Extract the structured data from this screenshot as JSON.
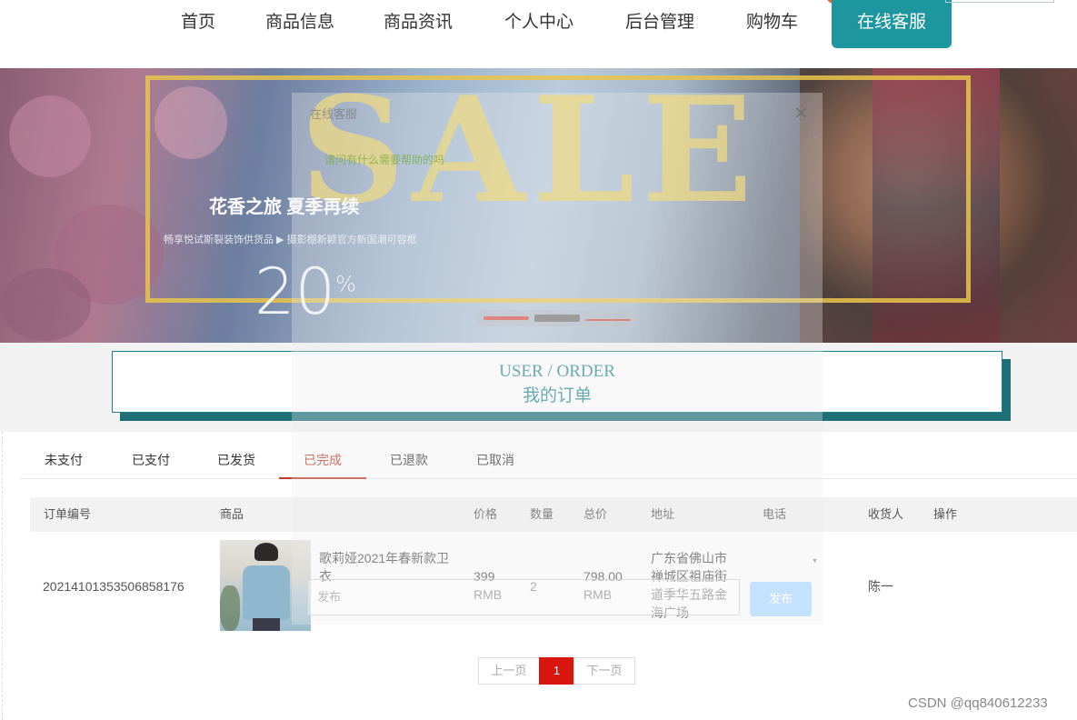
{
  "nav": {
    "items": [
      "首页",
      "商品信息",
      "商品资讯",
      "个人中心",
      "后台管理",
      "购物车"
    ],
    "service_button": "在线客服"
  },
  "banner": {
    "sale_text": "SALE",
    "subtitle": "花香之旅 夏季再续",
    "small_text": "畅享悦试斯裂装饰供货品 ▶   摄影棚新颖官方新国潮可容框",
    "percent": "20",
    "carousel_slides": 3,
    "carousel_active": 1
  },
  "section": {
    "title_en": "USER / ORDER",
    "title_cn": "我的订单"
  },
  "tabs": {
    "items": [
      "未支付",
      "已支付",
      "已发货",
      "已完成",
      "已退款",
      "已取消"
    ],
    "active": "已完成"
  },
  "table": {
    "headers": [
      "订单编号",
      "商品",
      "价格",
      "数量",
      "总价",
      "地址",
      "电话",
      "收货人",
      "操作"
    ],
    "rows": [
      {
        "order_no": "20214101353506858176",
        "product_name": "歌莉娅2021年春新款卫衣",
        "price": "399 RMB",
        "qty": "2",
        "total": "798.00 RMB",
        "address": "广东省佛山市禅城区祖庙街道季华五路金海广场",
        "phone": "",
        "receiver": "陈一",
        "action": ""
      }
    ]
  },
  "pager": {
    "prev": "上一页",
    "current": "1",
    "next": "下一页"
  },
  "chat": {
    "title": "在线客服",
    "close": "✕",
    "welcome": "请问有什么需要帮助的吗",
    "input_placeholder": "发布",
    "send_label": "发布"
  },
  "watermark": "CSDN @qq840612233",
  "colors": {
    "accent": "#1e96a0",
    "active_tab": "#c0392b",
    "pager_current": "#d9160e"
  }
}
